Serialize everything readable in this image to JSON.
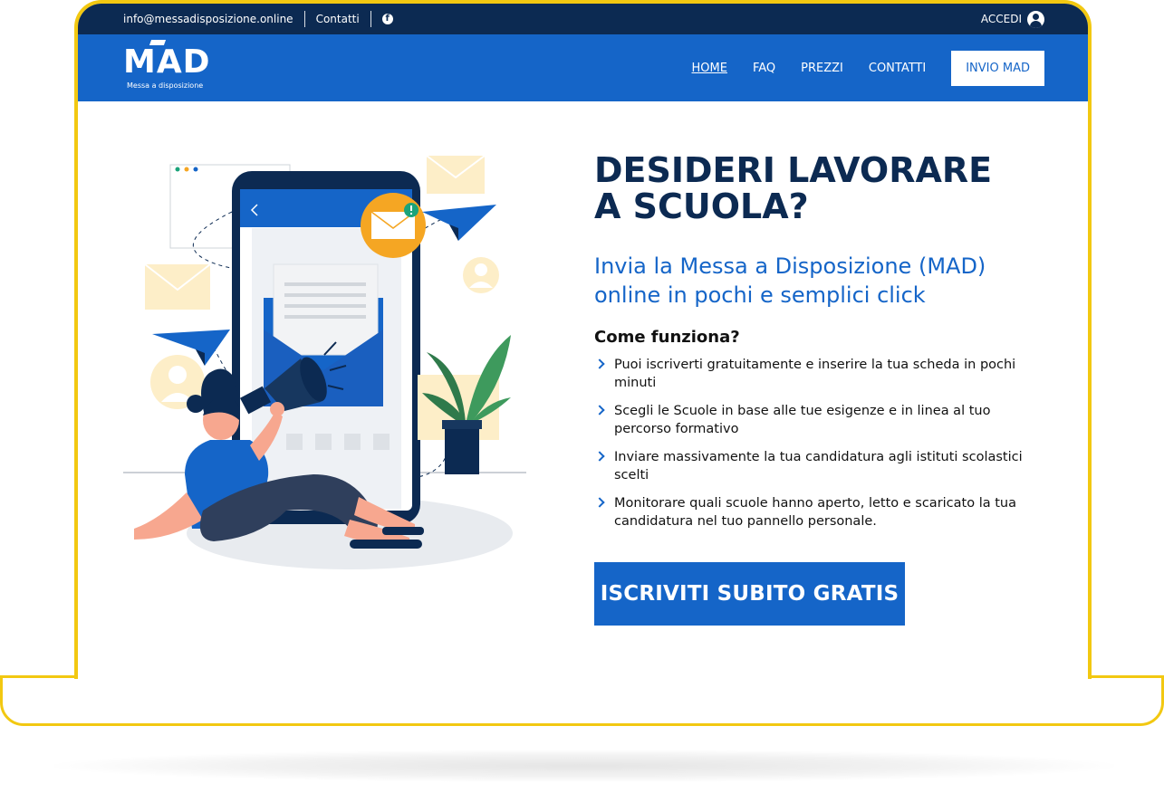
{
  "topbar": {
    "email": "info@messadisposizione.online",
    "contact_link": "Contatti",
    "facebook_icon": "facebook-icon",
    "login_label": "ACCEDI",
    "login_icon": "user-circle-icon"
  },
  "logo": {
    "word": "MAD",
    "subtitle": "Messa a disposizione"
  },
  "nav": {
    "items": [
      {
        "label": "HOME",
        "active": true
      },
      {
        "label": "FAQ"
      },
      {
        "label": "PREZZI"
      },
      {
        "label": "CONTATTI"
      }
    ],
    "cta_label": "INVIO MAD"
  },
  "hero": {
    "title": "DESIDERI LAVORARE A SCUOLA?",
    "subtitle": "Invia la Messa a Disposizione (MAD) online in pochi e semplici click",
    "how_title": "Come funziona?",
    "steps": [
      "Puoi iscriverti gratuitamente e inserire la tua scheda in pochi minuti",
      "Scegli le Scuole in base alle tue esigenze e in linea al tuo percorso formativo",
      "Inviare massivamente la tua candidatura agli istituti scolastici scelti",
      "Monitorare quali scuole hanno aperto, letto e scaricato la tua candidatura nel tuo pannello personale."
    ],
    "cta_label": "ISCRIVITI SUBITO GRATIS"
  },
  "colors": {
    "navy": "#0c2a52",
    "brand_blue": "#1565c8",
    "frame_yellow": "#f2c811",
    "accent_orange": "#f5a623"
  }
}
